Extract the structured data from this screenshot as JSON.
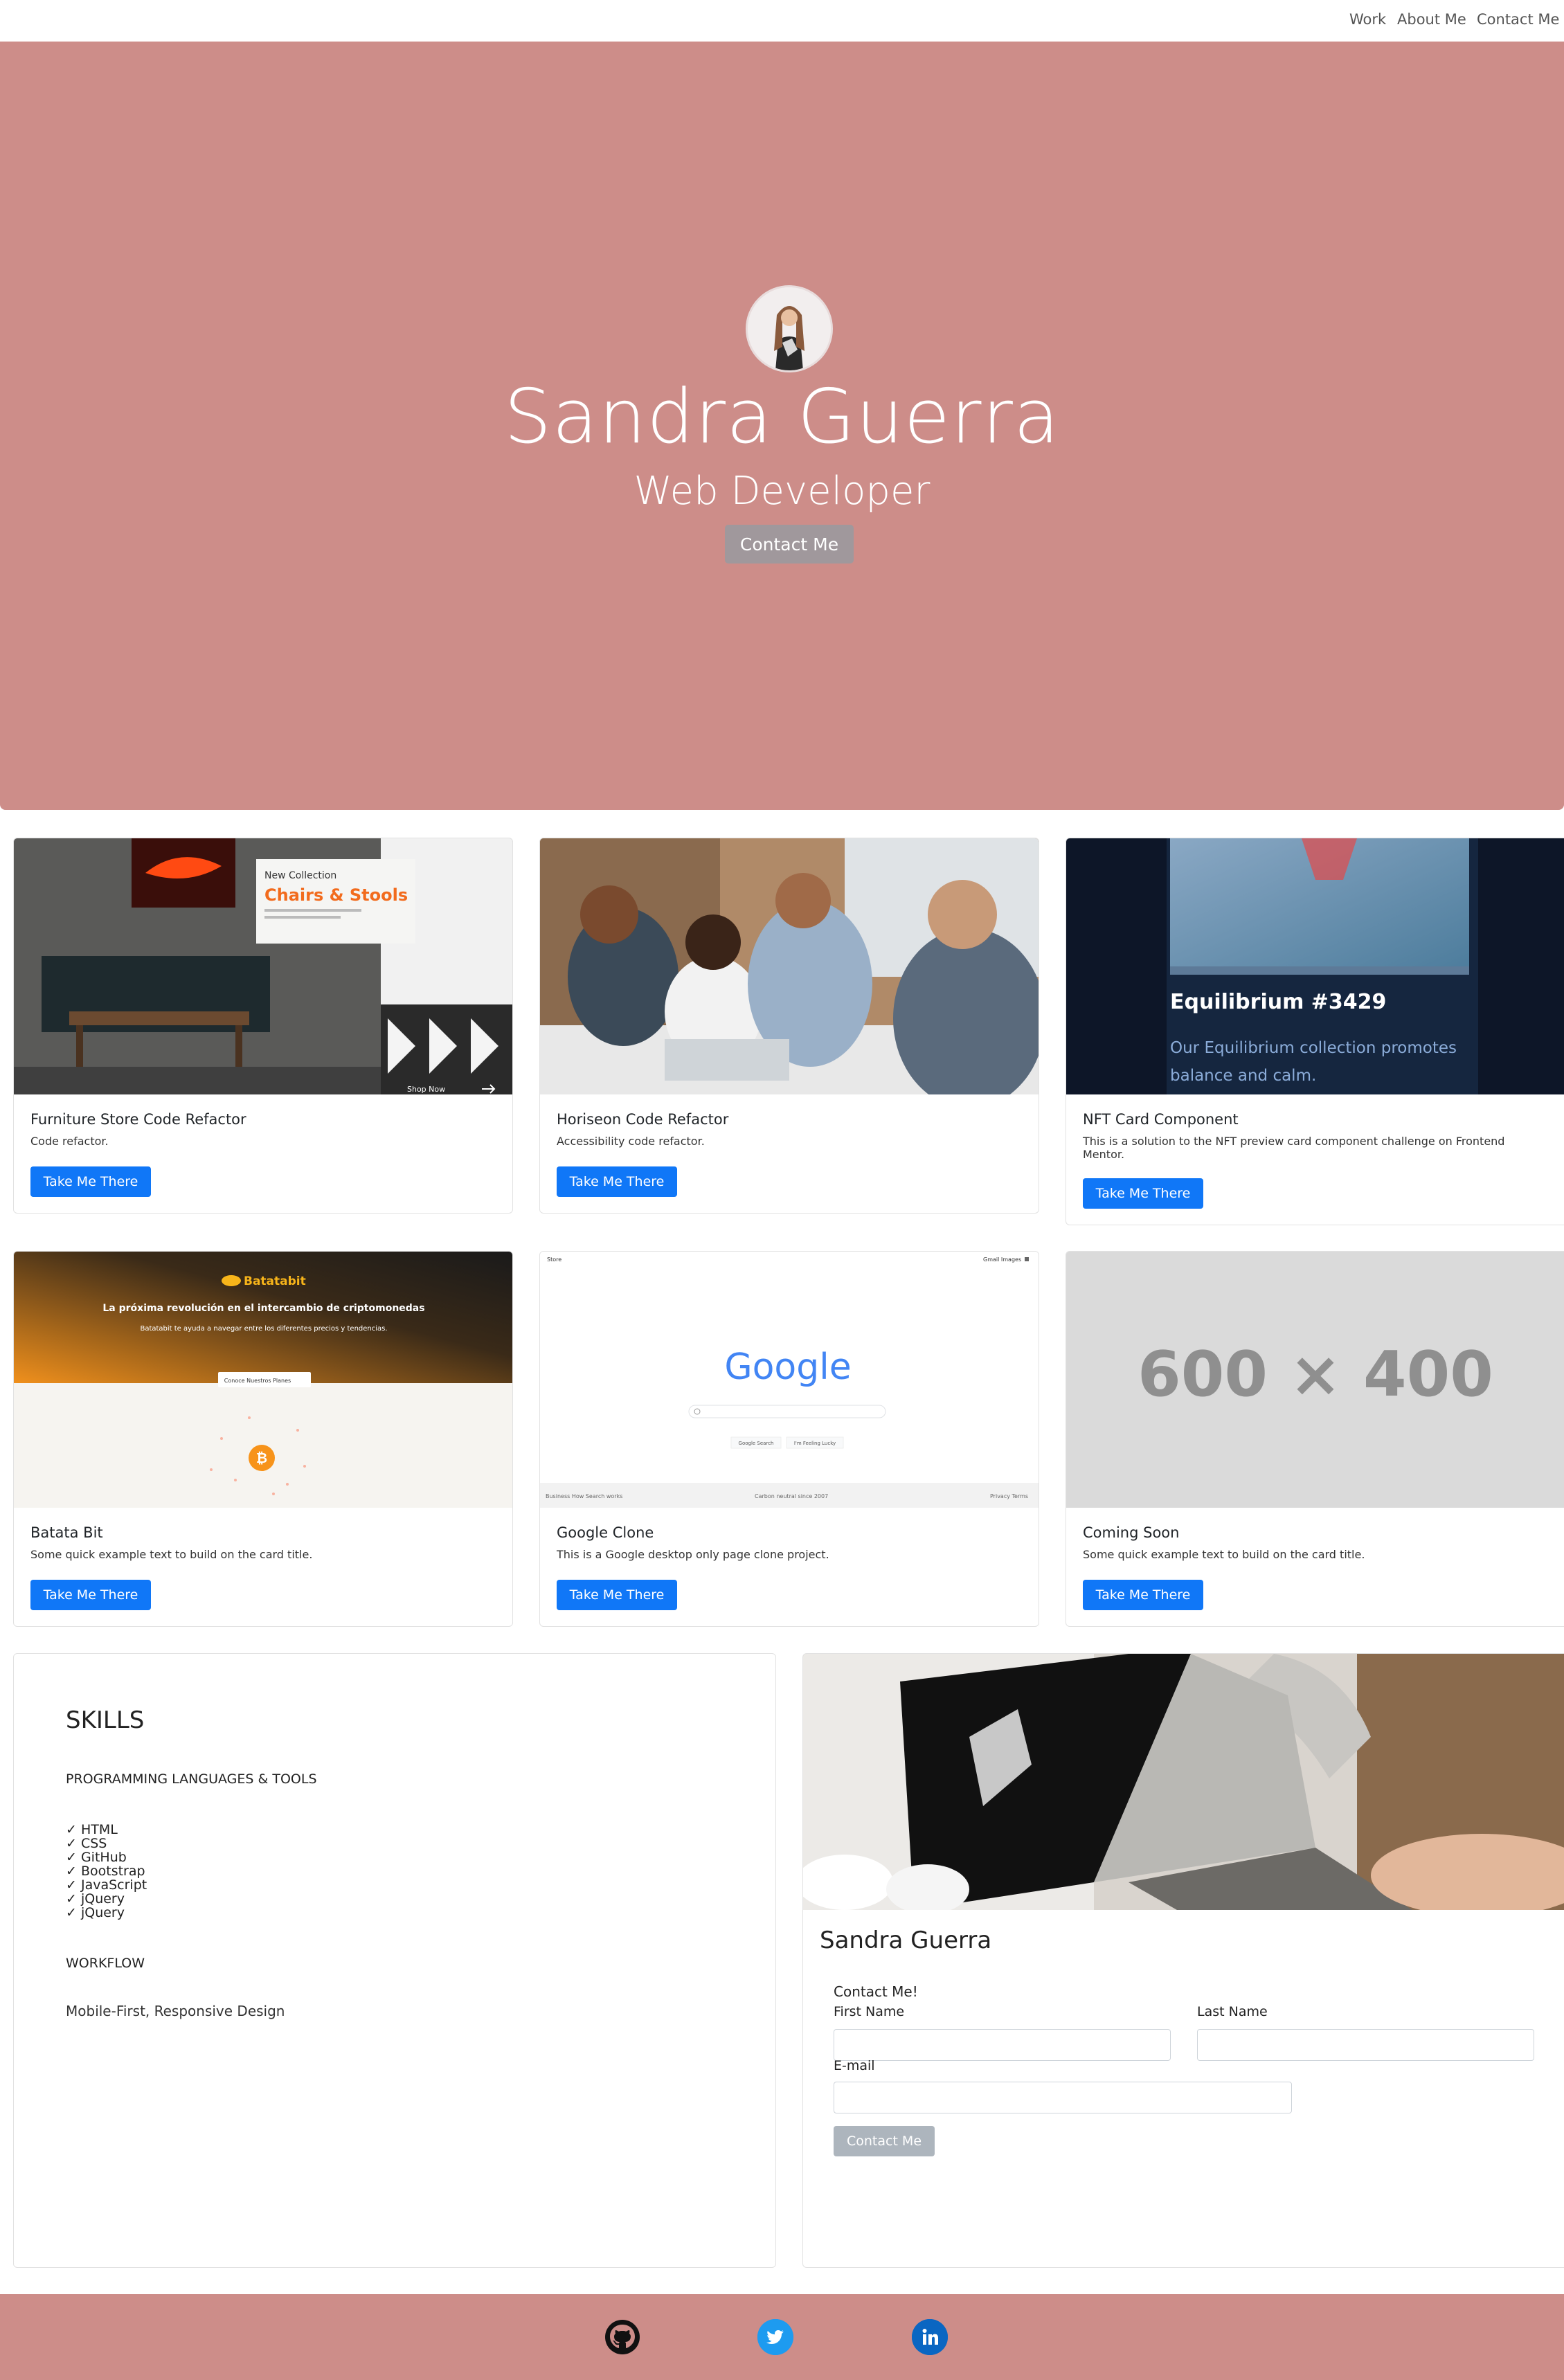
{
  "nav": {
    "items": [
      {
        "label": "Work"
      },
      {
        "label": "About Me"
      },
      {
        "label": "Contact Me"
      }
    ]
  },
  "hero": {
    "name": "Sandra Guerra",
    "role": "Web Developer",
    "button_label": "Contact Me"
  },
  "projects": [
    {
      "title": "Furniture Store Code Refactor",
      "text": "Code refactor.",
      "button_label": "Take Me There",
      "thumb": {
        "badge": "New Collection",
        "headline": "Chairs & Stools",
        "cta": "Shop Now"
      }
    },
    {
      "title": "Horiseon Code Refactor",
      "text": "Accessibility code refactor.",
      "button_label": "Take Me There"
    },
    {
      "title": "NFT Card Component",
      "text": "This is a solution to the NFT preview card component challenge on Frontend Mentor.",
      "button_label": "Take Me There",
      "thumb": {
        "headline": "Equilibrium #3429",
        "desc_line1": "Our Equilibrium collection promotes",
        "desc_line2": "balance and calm."
      }
    },
    {
      "title": "Batata Bit",
      "text": "Some quick example text to build on the card title.",
      "button_label": "Take Me There",
      "thumb": {
        "brand": "Batatabit",
        "headline": "La próxima revolución en el intercambio de criptomonedas",
        "sub": "Batatabit te ayuda a navegar entre los diferentes precios y tendencias.",
        "cta": "Conoce Nuestros Planes"
      }
    },
    {
      "title": "Google Clone",
      "text": "This is a Google desktop only page clone project.",
      "button_label": "Take Me There",
      "thumb": {
        "logo": "Google",
        "btn1": "Google Search",
        "btn2": "I'm Feeling Lucky",
        "top_left": "Store",
        "top_right": "Gmail  Images",
        "foot_left": "Business   How Search works",
        "foot_mid": "Carbon neutral since 2007",
        "foot_right": "Privacy   Terms"
      }
    },
    {
      "title": "Coming Soon",
      "text": "Some quick example text to build on the card title.",
      "button_label": "Take Me There",
      "thumb": {
        "placeholder": "600 × 400"
      }
    }
  ],
  "skills": {
    "title": "SKILLS",
    "subtitle": "PROGRAMMING LANGUAGES & TOOLS",
    "items": [
      "✓ HTML",
      "✓ CSS",
      "✓ GitHub",
      "✓ Bootstrap",
      "✓ JavaScript",
      "✓ jQuery",
      "✓ jQuery"
    ],
    "workflow_title": "WORKFLOW",
    "workflow_text": "Mobile-First, Responsive Design"
  },
  "contact": {
    "name": "Sandra Guerra",
    "heading": "Contact Me!",
    "first_name_label": "First Name",
    "last_name_label": "Last Name",
    "email_label": "E-mail",
    "first_name_value": "",
    "last_name_value": "",
    "email_value": "",
    "submit_label": "Contact Me"
  },
  "footer": {
    "icons": [
      "github-icon",
      "twitter-icon",
      "linkedin-icon"
    ]
  },
  "colors": {
    "brand": "#cd8d89",
    "button_primary": "#1077f7",
    "button_muted": "#adb5bd",
    "twitter": "#1d9bf0",
    "linkedin": "#0a66c2"
  }
}
